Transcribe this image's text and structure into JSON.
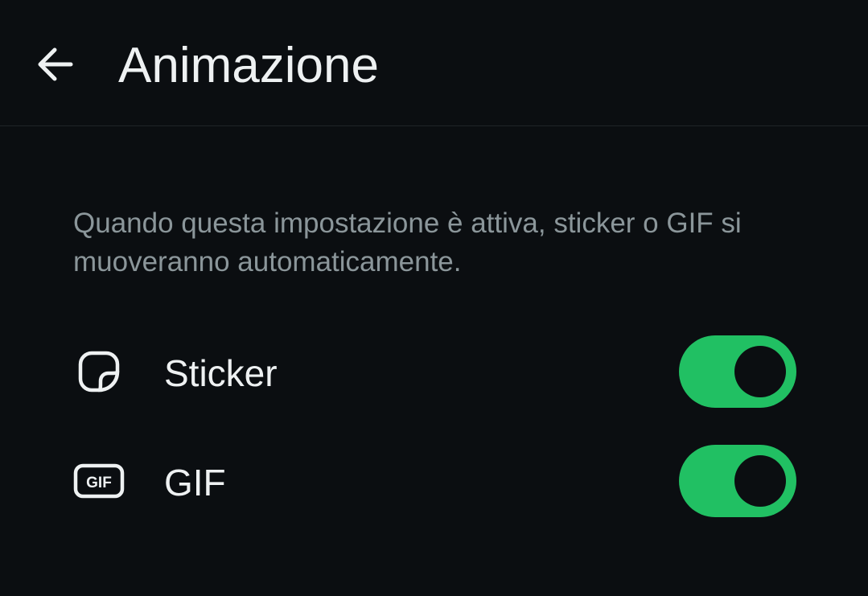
{
  "header": {
    "title": "Animazione",
    "back_icon": "arrow-left-icon"
  },
  "description": "Quando questa impostazione è attiva, sticker o GIF si muoveranno automaticamente.",
  "settings": [
    {
      "label": "Sticker",
      "icon": "sticker-icon",
      "enabled": true
    },
    {
      "label": "GIF",
      "icon": "gif-icon",
      "enabled": true
    }
  ],
  "colors": {
    "background": "#0b0e11",
    "accent": "#21c063",
    "text_primary": "#eef1f2",
    "text_secondary": "#8b969a"
  }
}
